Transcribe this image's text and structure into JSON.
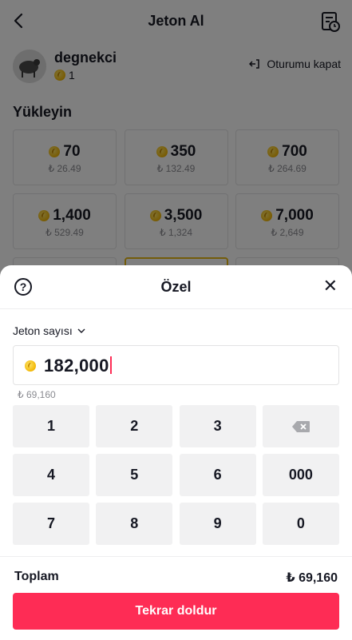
{
  "header": {
    "title": "Jeton Al"
  },
  "user": {
    "name": "degnekci",
    "coins": "1",
    "logout_label": "Oturumu kapat"
  },
  "section_title": "Yükleyin",
  "packages": [
    {
      "amount": "70",
      "price": "₺ 26.49"
    },
    {
      "amount": "350",
      "price": "₺ 132.49"
    },
    {
      "amount": "700",
      "price": "₺ 264.69"
    },
    {
      "amount": "1,400",
      "price": "₺ 529.49"
    },
    {
      "amount": "3,500",
      "price": "₺ 1,324"
    },
    {
      "amount": "7,000",
      "price": "₺ 2,649"
    }
  ],
  "sheet": {
    "title": "Özel",
    "dropdown_label": "Jeton sayısı",
    "input_value": "182,000",
    "converted": "₺ 69,160",
    "keys": [
      "1",
      "2",
      "3",
      "backspace",
      "4",
      "5",
      "6",
      "000",
      "7",
      "8",
      "9",
      "0"
    ],
    "total_label": "Toplam",
    "total_value": "₺ 69,160",
    "button_label": "Tekrar doldur"
  },
  "colors": {
    "accent": "#fe2c55",
    "coin": "#f2b705",
    "selected_border": "#e6b814"
  },
  "icons": [
    "back-icon",
    "history-icon",
    "logout-icon",
    "coin-icon",
    "help-icon",
    "close-icon",
    "chevron-down-icon",
    "backspace-icon"
  ]
}
